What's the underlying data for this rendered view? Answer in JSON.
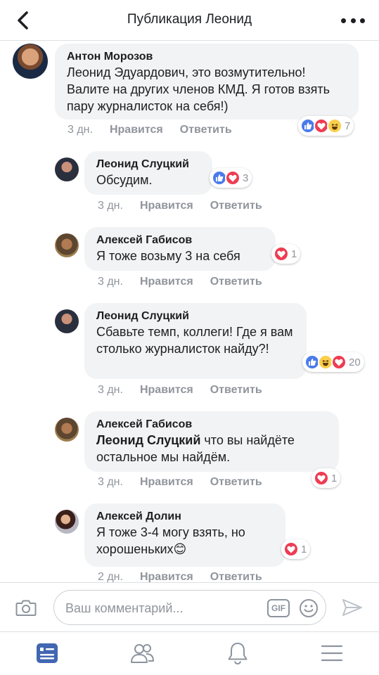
{
  "header": {
    "title": "Публикация Леонид"
  },
  "comments": [
    {
      "author": "Антон Морозов",
      "text": "Леонид Эдуардович, это возмутительно! Валите на других членов КМД. Я готов взять пару журналисток на себя!)",
      "time": "3 дн.",
      "like_label": "Нравится",
      "reply_label": "Ответить",
      "reactions": [
        "like",
        "love",
        "haha"
      ],
      "reaction_count": "7"
    },
    {
      "author": "Леонид Слуцкий",
      "text": "Обсудим.",
      "time": "3 дн.",
      "like_label": "Нравится",
      "reply_label": "Ответить",
      "reactions": [
        "like",
        "love"
      ],
      "reaction_count": "3"
    },
    {
      "author": "Алексей Габисов",
      "text": "Я тоже возьму 3 на себя",
      "time": "3 дн.",
      "like_label": "Нравится",
      "reply_label": "Ответить",
      "reactions": [
        "love"
      ],
      "reaction_count": "1"
    },
    {
      "author": "Леонид Слуцкий",
      "text": "Сбавьте темп, коллеги! Где я вам столько журналисток найду?!",
      "time": "3 дн.",
      "like_label": "Нравится",
      "reply_label": "Ответить",
      "reactions": [
        "like",
        "haha",
        "love"
      ],
      "reaction_count": "20"
    },
    {
      "author": "Алексей Габисов",
      "mention": "Леонид Слуцкий",
      "text": " что вы найдёте остальное мы найдём.",
      "time": "3 дн.",
      "like_label": "Нравится",
      "reply_label": "Ответить",
      "reactions": [
        "love"
      ],
      "reaction_count": "1"
    },
    {
      "author": "Алексей Долин",
      "text": "Я тоже 3-4 могу взять, но хорошеньких",
      "emoji": "😊",
      "time": "2 дн.",
      "like_label": "Нравится",
      "reply_label": "Ответить",
      "reactions": [
        "love"
      ],
      "reaction_count": "1"
    }
  ],
  "composer": {
    "placeholder": "Ваш комментарий...",
    "gif_label": "GIF"
  },
  "tabbar": {
    "items": [
      "news-feed",
      "friends",
      "notifications",
      "menu"
    ]
  },
  "colors": {
    "accent": "#4267b2",
    "like": "#4a7bea",
    "love": "#ee3c52",
    "haha": "#fbcf4b",
    "bubble": "#f2f3f5",
    "meta": "#90949c"
  }
}
